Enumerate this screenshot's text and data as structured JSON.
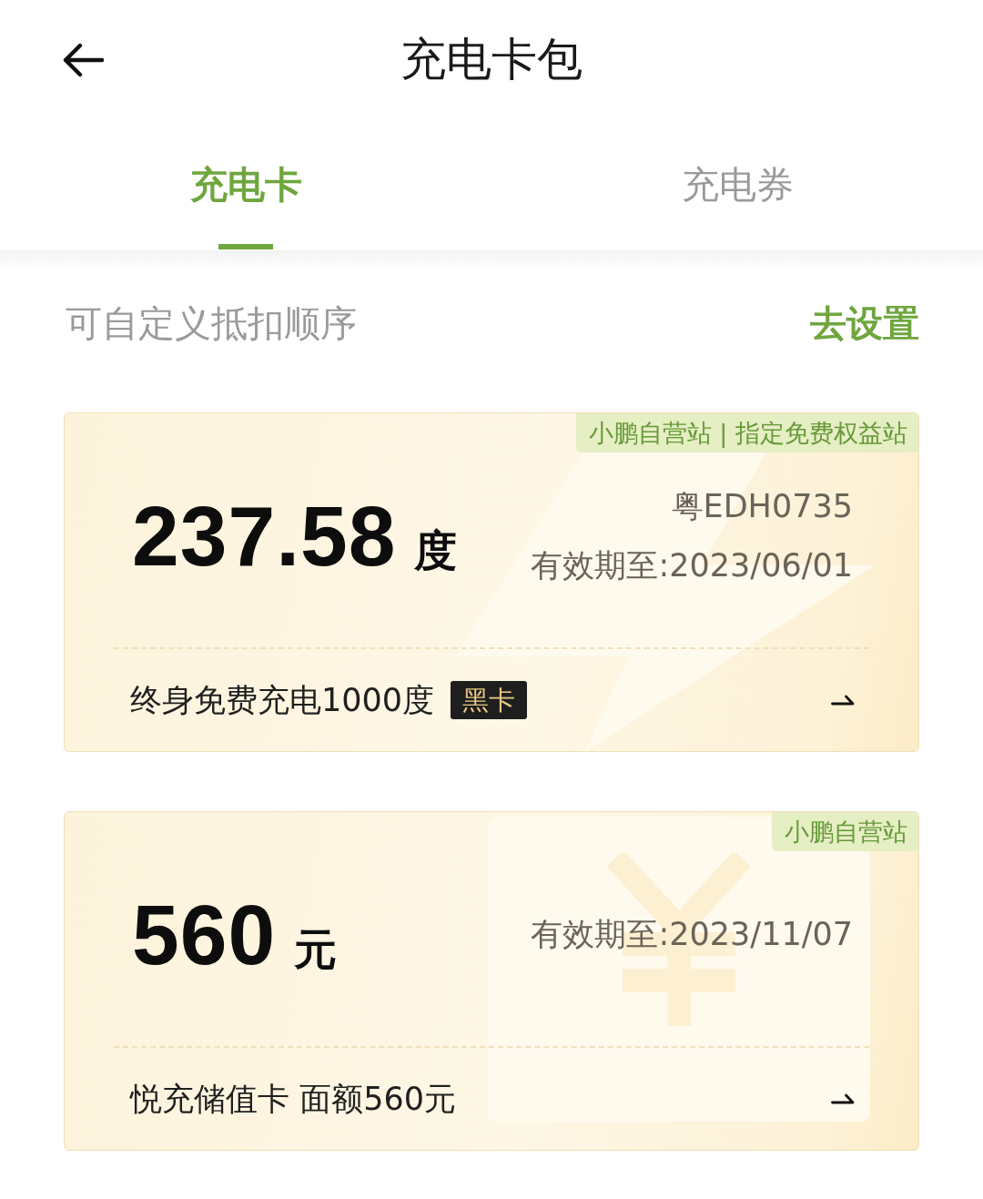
{
  "header": {
    "title": "充电卡包"
  },
  "tabs": [
    {
      "label": "充电卡",
      "selected": true
    },
    {
      "label": "充电券",
      "selected": false
    }
  ],
  "order_bar": {
    "hint": "可自定义抵扣顺序",
    "action": "去设置"
  },
  "cards": [
    {
      "kind": "energy",
      "tag": "小鹏自营站 | 指定免费权益站",
      "amount": "237.58",
      "unit": "度",
      "plate": "粤EDH0735",
      "expiry": "有效期至:2023/06/01",
      "description": "终身免费充电1000度",
      "badge": "黑卡"
    },
    {
      "kind": "balance",
      "tag": "小鹏自营站",
      "amount": "560",
      "unit": "元",
      "expiry": "有效期至:2023/11/07",
      "description": "悦充储值卡 面额560元"
    }
  ]
}
